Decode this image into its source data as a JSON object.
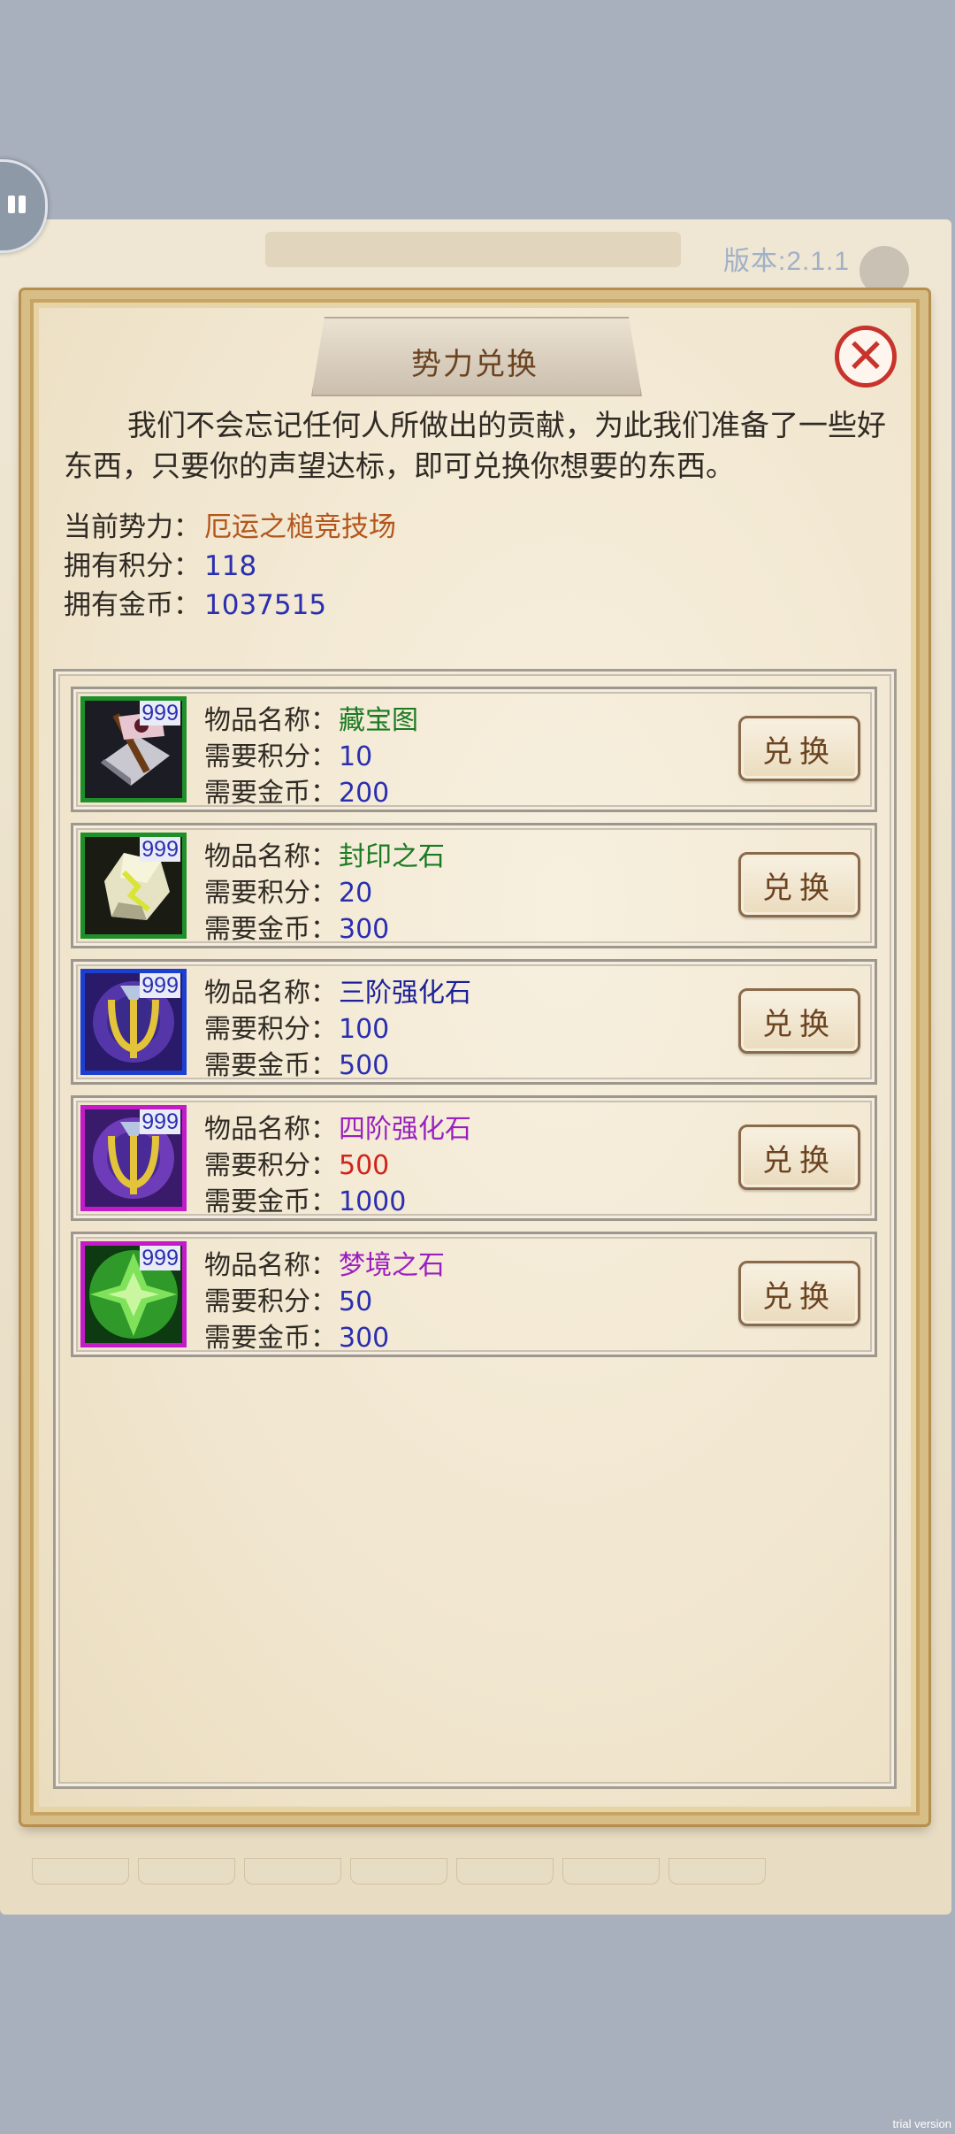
{
  "version": "版本:2.1.1",
  "title": "势力兑换",
  "intro": "我们不会忘记任何人所做出的贡献，为此我们准备了一些好东西，只要你的声望达标，即可兑换你想要的东西。",
  "info": {
    "faction_label": "当前势力：",
    "faction_value": "厄运之槌竞技场",
    "points_label": "拥有积分：",
    "points_value": "118",
    "gold_label": "拥有金币：",
    "gold_value": "1037515"
  },
  "labels": {
    "name": "物品名称：",
    "points": "需要积分：",
    "gold": "需要金币：",
    "exchange": "兑换"
  },
  "colors": {
    "faction": "#b4561c",
    "number": "#2a2fb0",
    "insufficient": "#d0231b",
    "green_name": "#1a7a22",
    "blue_name": "#1a1f9a",
    "purple_name": "#9b1fbf"
  },
  "items": [
    {
      "name": "藏宝图",
      "points": "10",
      "gold": "200",
      "qty": "999",
      "icon": "treasure-map-icon"
    },
    {
      "name": "封印之石",
      "points": "20",
      "gold": "300",
      "qty": "999",
      "icon": "sealing-stone-icon"
    },
    {
      "name": "三阶强化石",
      "points": "100",
      "gold": "500",
      "qty": "999",
      "icon": "tier3-enhance-stone-icon"
    },
    {
      "name": "四阶强化石",
      "points": "500",
      "gold": "1000",
      "qty": "999",
      "icon": "tier4-enhance-stone-icon"
    },
    {
      "name": "梦境之石",
      "points": "50",
      "gold": "300",
      "qty": "999",
      "icon": "dream-stone-icon"
    }
  ],
  "watermark": "trial version"
}
